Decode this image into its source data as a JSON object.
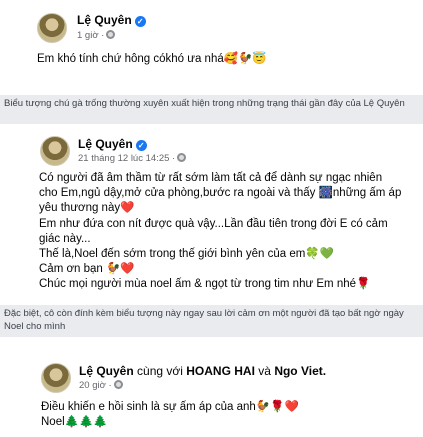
{
  "post1": {
    "author": "Lệ Quyên",
    "time": "1 giờ ·",
    "lines": [
      "Em khó tính chứ hông cókhó ưa nhá🥰🐓😇"
    ]
  },
  "caption1": "Biểu tượng chú gà trống thường xuyên xuất hiện trong những trạng thái gần đây của Lệ Quyên",
  "post2": {
    "author": "Lệ Quyên",
    "time": "21 tháng 12 lúc 14:25 ·",
    "lines": [
      "Có người đã âm thầm từ rất sớm làm tất cả để dành sự ngạc nhiên",
      "cho Em,ngủ dậy,mở cửa phòng,bước ra ngoài và thấy 🎆những ấm áp",
      "yêu thương này❤️",
      "Em như đứa con nít được quà vậy...Lần đầu tiên trong đời E có cảm",
      "giác này...",
      "Thế là,Noel đến sớm trong thế giới bình yên của em🍀💚",
      "Cảm ơn bạn 🐓❤️",
      "Chúc mọi người mùa noel ấm & ngọt từ trong tim như Em nhé🌹"
    ]
  },
  "caption2": "Đặc biệt, cô còn đính kèm biểu tượng này ngay sau lời cảm ơn một người đã tạo bất ngờ ngày Noel cho mình",
  "post3": {
    "author": "Lệ Quyên",
    "with_word": "cùng với",
    "tag1": "HOANG HAI",
    "and_word": "và",
    "tag2": "Ngo Viet.",
    "time": "20 giờ ·",
    "lines": [
      "Điều khiến e hồi sinh là sự ấm áp của anh🐓🌹❤️",
      "Noel🌲🌲🌲"
    ]
  },
  "icons": {
    "verified": "verified-badge-icon",
    "privacy": "globe-icon"
  },
  "colors": {
    "verified": "#1877f2",
    "caption_bg": "#e9ebee",
    "meta": "#65676b"
  }
}
